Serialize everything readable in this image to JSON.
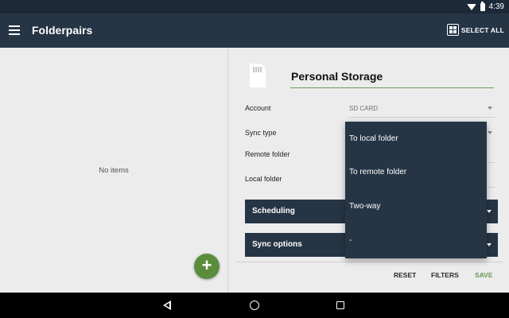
{
  "status_bar": {
    "time": "4:39",
    "icons": [
      "wifi-icon",
      "battery-icon"
    ]
  },
  "app_bar": {
    "title": "Folderpairs",
    "select_all_label": "SELECT ALL",
    "icons": [
      "menu-icon",
      "select-all-grid-icon"
    ]
  },
  "list": {
    "empty_text": "No items",
    "fab_label": "+"
  },
  "form": {
    "name": "Personal Storage",
    "account_label": "Account",
    "account_value": "SD CARD",
    "sync_type_label": "Sync type",
    "remote_folder_label": "Remote folder",
    "local_folder_label": "Local folder",
    "sections": [
      "Scheduling",
      "Sync options"
    ]
  },
  "dropdown": {
    "options": [
      "To local folder",
      "To remote folder",
      "Two-way",
      "-"
    ]
  },
  "actions": {
    "reset": "RESET",
    "filters": "FILTERS",
    "save": "SAVE"
  },
  "nav_bar": {
    "icons": [
      "back-icon",
      "home-icon",
      "recent-apps-icon"
    ]
  },
  "colors": {
    "primary": "#263545",
    "status_bar": "#1c2a38",
    "accent": "#5a8c3c",
    "background": "#ececec"
  }
}
